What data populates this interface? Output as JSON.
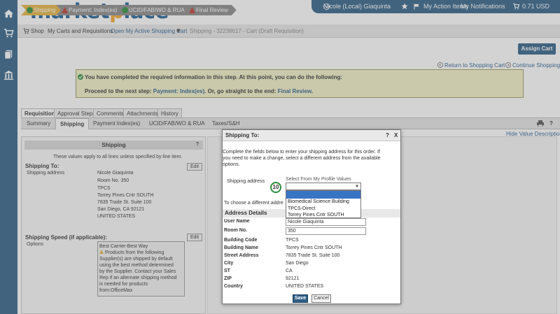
{
  "header": {
    "logo_part1": "market",
    "logo_part2": "p",
    "logo_part3": "lace",
    "user": "Nicole (Local) Giaquinta",
    "action_items": "My Action Items",
    "notifications": "My Notifications",
    "cart_total": "0.71 USD"
  },
  "breadcrumb": {
    "shop": "Shop",
    "carts": "My Carts and Requisitions",
    "open_cart": "Open My Active Shopping Cart",
    "current": "Shipping - 32238617 - Cart (Draft Requisition)"
  },
  "workflow": {
    "steps": [
      "Shipping",
      "Payment: Index(es)",
      "UCID/FAB/WO & RUA",
      "Final Review"
    ],
    "assign_cart": "Assign Cart",
    "return_link": "Return to Shopping Cart",
    "continue_link": "Continue Shopping"
  },
  "notice": {
    "line1": "You have completed the required information in this step. At this point, you can do the following:",
    "line2_pre": "Proceed to the next step: ",
    "line2_link1": "Payment: Index(es)",
    "line2_mid": ". Or, go straight to the end: ",
    "line2_link2": "Final Review",
    "line2_post": "."
  },
  "tabs": [
    "Requisition",
    "Approval Steps",
    "Comments",
    "Attachments",
    "History"
  ],
  "subtabs": [
    "Summary",
    "Shipping",
    "Payment Index(es)",
    "UCID/FAB/WO & RUA",
    "Taxes/S&H"
  ],
  "hide_desc": "Hide Value Descriptions",
  "panel": {
    "title": "Shipping",
    "note": "These values apply to all lines unless specified by line item.",
    "ship_to_label": "Shipping To:",
    "shipping_address_label": "Shipping address",
    "edit": "Edit",
    "address_lines": [
      "Nicole Giaquinta",
      "Room No. 350",
      "TPCS",
      "Torrey Pines Cntr SOUTH",
      "7835 Trade St. Suite 100",
      "San Diego, CA 92121",
      "UNITED STATES"
    ],
    "speed_label": "Shipping Speed (if applicable):",
    "options_label": "Options",
    "speed_title": "Best Carrier-Best Way",
    "speed_lines": [
      "Products from the following",
      "Supplier(s) are shipped by default",
      "using the best method determined",
      "by the Supplier. Contact your Sales",
      "Rep if an alternate shipping method",
      "is needed for products",
      "from:OfficeMax"
    ]
  },
  "modal": {
    "title": "Shipping To:",
    "help": "?",
    "close": "X",
    "intro_lines": [
      "Complete the fields below to enter your shipping address for this order. If",
      "you need to make a change, select a different address from the available",
      "options."
    ],
    "shipping_address_label": "Shipping address",
    "select_hint": "Select From My Profile Values",
    "choose_text": "To choose a different addre",
    "options": [
      "Biomedical Science Building",
      "TPCS-Direct",
      "Torrey Pines Cntr SOUTH"
    ],
    "address_details": "Address Details",
    "fields": [
      {
        "label": "User Name",
        "value": "Nicole Giaquinta"
      },
      {
        "label": "Room No.",
        "value": "350"
      }
    ],
    "static_fields": [
      {
        "label": "Building Code",
        "value": "TPCS"
      },
      {
        "label": "Building Name",
        "value": "Torrey Pines Cntr SOUTH"
      },
      {
        "label": "Street Address",
        "value": "7835 Trade St. Suite 100"
      },
      {
        "label": "City",
        "value": "San Diego"
      },
      {
        "label": "ST",
        "value": "CA"
      },
      {
        "label": "ZIP",
        "value": "92121"
      },
      {
        "label": "Country",
        "value": "UNITED STATES"
      }
    ],
    "save": "Save",
    "cancel": "Cancel"
  },
  "badge": "10",
  "colors": {
    "brand_blue": "#2f5f86",
    "logo_orange": "#f2a52c",
    "step_active": "#e5b341",
    "notice_bg": "#f3f1c8",
    "badge_green": "#2e8f3c"
  }
}
